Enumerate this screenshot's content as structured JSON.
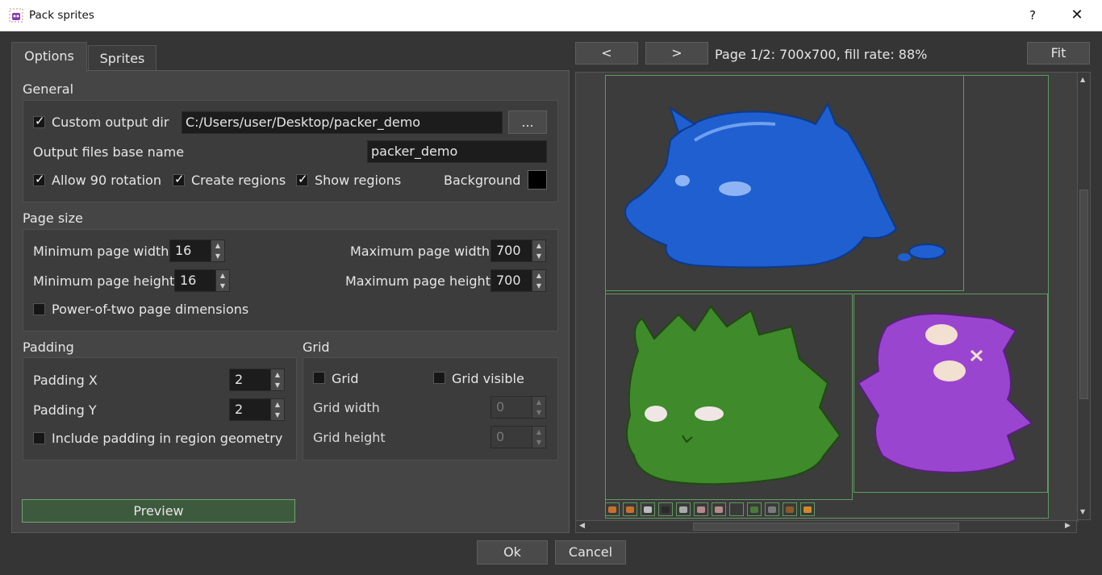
{
  "window": {
    "title": "Pack sprites",
    "help_label": "?",
    "close_label": "✕"
  },
  "tabs": [
    {
      "label": "Options",
      "active": true
    },
    {
      "label": "Sprites",
      "active": false
    }
  ],
  "general": {
    "section_label": "General",
    "custom_output_dir": {
      "label": "Custom output dir",
      "checked": true,
      "value": "C:/Users/user/Desktop/packer_demo",
      "browse_label": "..."
    },
    "output_base_name": {
      "label": "Output files base name",
      "value": "packer_demo"
    },
    "allow_rotation": {
      "label": "Allow 90 rotation",
      "checked": true
    },
    "create_regions": {
      "label": "Create regions",
      "checked": true
    },
    "show_regions": {
      "label": "Show regions",
      "checked": true
    },
    "background": {
      "label": "Background",
      "color": "#000000"
    }
  },
  "page_size": {
    "section_label": "Page size",
    "min_width": {
      "label": "Minimum page width",
      "value": "16"
    },
    "min_height": {
      "label": "Minimum page height",
      "value": "16"
    },
    "max_width": {
      "label": "Maximum page width",
      "value": "700"
    },
    "max_height": {
      "label": "Maximum page height",
      "value": "700"
    },
    "power_of_two": {
      "label": "Power-of-two page dimensions",
      "checked": false
    }
  },
  "padding": {
    "section_label": "Padding",
    "padding_x": {
      "label": "Padding X",
      "value": "2"
    },
    "padding_y": {
      "label": "Padding Y",
      "value": "2"
    },
    "include_padding": {
      "label": "Include padding in region geometry",
      "checked": false
    }
  },
  "grid": {
    "section_label": "Grid",
    "grid": {
      "label": "Grid",
      "checked": false
    },
    "grid_visible": {
      "label": "Grid visible",
      "checked": false
    },
    "grid_width": {
      "label": "Grid width",
      "value": "0"
    },
    "grid_height": {
      "label": "Grid height",
      "value": "0"
    }
  },
  "preview_button": "Preview",
  "preview": {
    "prev_label": "<",
    "next_label": ">",
    "status": "Page 1/2: 700x700, fill rate: 88%",
    "fit_label": "Fit",
    "sprites": [
      {
        "name": "blue-slime-sprite",
        "color": "#1f5fd0"
      },
      {
        "name": "green-slime-sprite",
        "color": "#3f8a2a"
      },
      {
        "name": "purple-ghost-sprite",
        "color": "#9a45d0"
      }
    ],
    "thumb_colors": [
      "#c8702a",
      "#c8702a",
      "#bbbbbb",
      "#2a2a2a",
      "#aaaaaa",
      "#b58a8a",
      "#b58a8a",
      "#3a3a3a",
      "#4a7a3a",
      "#7a7a7a",
      "#8a5a2a",
      "#d08a2a"
    ]
  },
  "footer": {
    "ok_label": "Ok",
    "cancel_label": "Cancel"
  }
}
